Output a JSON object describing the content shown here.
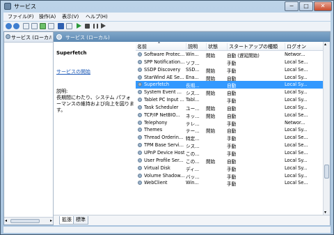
{
  "window": {
    "title": "サービス",
    "min_label": "−",
    "max_label": "□",
    "close_label": "✕"
  },
  "menu": [
    "ファイル(F)",
    "操作(A)",
    "表示(V)",
    "ヘルプ(H)"
  ],
  "left_pane": {
    "header": "サービス (ローカル)"
  },
  "right_pane": {
    "header": "サービス (ローカル)"
  },
  "detail": {
    "name": "Superfetch",
    "start_link": "サービスの開始",
    "desc_label": "説明:",
    "desc_text": "長期間にわたり、システム パフォーマンスの維持および向上を図ります。"
  },
  "columns": [
    "名前",
    "説明",
    "状態",
    "スタートアップの種類",
    "ログオン"
  ],
  "rows": [
    {
      "name": "Software Protec...",
      "desc": "Win...",
      "status": "開始",
      "startup": "自動 (遅延開始)",
      "logon": "Networ..."
    },
    {
      "name": "SPP Notification...",
      "desc": "ソフ...",
      "status": "",
      "startup": "手動",
      "logon": "Local Se..."
    },
    {
      "name": "SSDP Discovery",
      "desc": "SSD...",
      "status": "開始",
      "startup": "手動",
      "logon": "Local Se..."
    },
    {
      "name": "StarWind AE Se...",
      "desc": "Ena...",
      "status": "開始",
      "startup": "自動",
      "logon": "Local Sy..."
    },
    {
      "name": "Superfetch",
      "desc": "長期...",
      "status": "",
      "startup": "自動",
      "logon": "Local Sy...",
      "selected": true
    },
    {
      "name": "System Event ...",
      "desc": "シス...",
      "status": "開始",
      "startup": "自動",
      "logon": "Local Sy..."
    },
    {
      "name": "Tablet PC Input ...",
      "desc": "Tabl...",
      "status": "",
      "startup": "手動",
      "logon": "Local Sy..."
    },
    {
      "name": "Task Scheduler",
      "desc": "ユー...",
      "status": "開始",
      "startup": "自動",
      "logon": "Local Sy..."
    },
    {
      "name": "TCP/IP NetBIO...",
      "desc": "ネッ...",
      "status": "開始",
      "startup": "自動",
      "logon": "Local Se..."
    },
    {
      "name": "Telephony",
      "desc": "テレ...",
      "status": "",
      "startup": "手動",
      "logon": "Networ..."
    },
    {
      "name": "Themes",
      "desc": "テー...",
      "status": "開始",
      "startup": "自動",
      "logon": "Local Sy..."
    },
    {
      "name": "Thread Orderin...",
      "desc": "特定...",
      "status": "",
      "startup": "手動",
      "logon": "Local Se..."
    },
    {
      "name": "TPM Base Servi...",
      "desc": "シス...",
      "status": "",
      "startup": "手動",
      "logon": "Local Se..."
    },
    {
      "name": "UPnP Device Host",
      "desc": "この...",
      "status": "",
      "startup": "手動",
      "logon": "Local Se..."
    },
    {
      "name": "User Profile Ser...",
      "desc": "この...",
      "status": "開始",
      "startup": "自動",
      "logon": "Local Sy..."
    },
    {
      "name": "Virtual Disk",
      "desc": "ディ...",
      "status": "",
      "startup": "手動",
      "logon": "Local Sy..."
    },
    {
      "name": "Volume Shadow...",
      "desc": "バッ...",
      "status": "",
      "startup": "手動",
      "logon": "Local Sy..."
    },
    {
      "name": "WebClient",
      "desc": "Win...",
      "status": "",
      "startup": "手動",
      "logon": "Local Se..."
    }
  ],
  "tabs": [
    "拡張",
    "標準"
  ],
  "colors": {
    "selection": "#3399ff",
    "header": "#5d89b3",
    "link": "#1a57b6"
  }
}
